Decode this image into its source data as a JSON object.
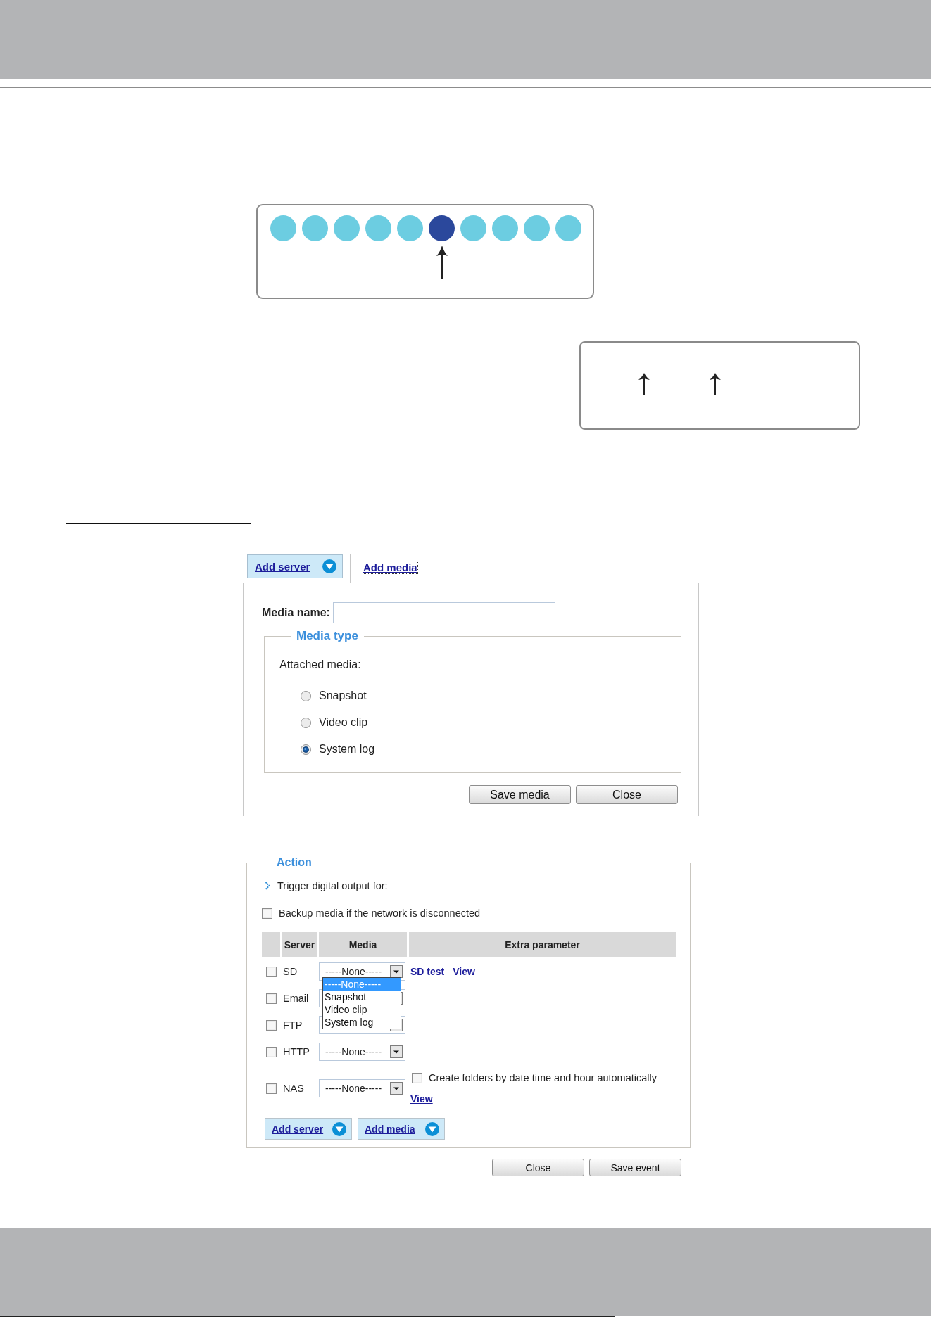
{
  "diagram": {
    "dots": [
      {
        "selected": false
      },
      {
        "selected": false
      },
      {
        "selected": false
      },
      {
        "selected": false
      },
      {
        "selected": false
      },
      {
        "selected": true
      },
      {
        "selected": false
      },
      {
        "selected": false
      },
      {
        "selected": false
      },
      {
        "selected": false
      }
    ]
  },
  "media_dialog": {
    "tabs": [
      {
        "label": "Add server",
        "selected": false
      },
      {
        "label": "Add media",
        "selected": true
      }
    ],
    "media_name": {
      "label": "Media name:"
    },
    "media_type": {
      "legend": "Media type",
      "prompt": "Attached media:",
      "options": [
        {
          "label": "Snapshot",
          "selected": false
        },
        {
          "label": "Video clip",
          "selected": false
        },
        {
          "label": "System log",
          "selected": true
        }
      ]
    },
    "buttons": [
      "Save media",
      "Close"
    ]
  },
  "action": {
    "legend": "Action",
    "trigger": "Trigger digital output for:",
    "backup": {
      "label": "Backup media if the network is disconnected",
      "checked": false
    },
    "table": {
      "columns": [
        "Server",
        "Media",
        "Extra parameter"
      ],
      "rows": [
        {
          "server": "SD",
          "checked": false,
          "media": "-----None-----",
          "options": [
            {
              "label": "-----None-----",
              "selected": true
            },
            {
              "label": "Snapshot",
              "selected": false
            },
            {
              "label": "Video clip",
              "selected": false
            },
            {
              "label": "System log",
              "selected": false
            }
          ],
          "links": [
            "SD test",
            "View"
          ]
        },
        {
          "server": "Email",
          "checked": false
        },
        {
          "server": "FTP",
          "checked": false
        },
        {
          "server": "HTTP",
          "checked": false,
          "media": "-----None-----"
        },
        {
          "server": "NAS",
          "checked": false,
          "media": "-----None-----",
          "option": {
            "label": "Create folders by date time and hour automatically",
            "checked": false
          },
          "links": [
            "View"
          ]
        }
      ]
    },
    "add_buttons": [
      "Add server",
      "Add media"
    ]
  },
  "buttons": [
    "Close",
    "Save event"
  ]
}
